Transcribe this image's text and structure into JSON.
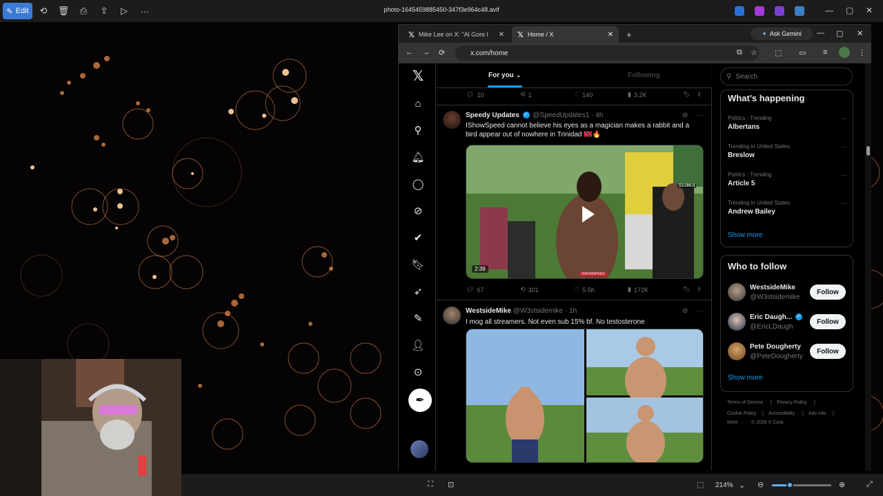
{
  "viewer": {
    "edit_label": "Edit",
    "file_name": "photo-1645459885450-347f3e964c48.avif",
    "zoom": "214%",
    "zoom_level_fraction": 0.3
  },
  "browser": {
    "tabs": [
      {
        "label": "Mike Lee on X: \"Al Gore has ca",
        "active": false
      },
      {
        "label": "Home / X",
        "active": true
      }
    ],
    "ask_gemini": "Ask Gemini",
    "url": "x.com/home"
  },
  "feed": {
    "tabs": {
      "for_you": "For you",
      "following": "Following"
    },
    "top_actions": {
      "replies": "10",
      "reposts": "1",
      "likes": "140",
      "views": "3.2K"
    },
    "posts": [
      {
        "name": "Speedy Updates",
        "handle": "@SpeedUpdates1",
        "time": "· 4h",
        "text": "IShowSpeed cannot believe his eyes as a magician makes a rabbit and a bird appear out of nowhere in Trinidad 🇹🇹🔥",
        "video_duration": "2:39",
        "video_overlay_count": "53,086,9",
        "video_watermark": "ISHOWSPEED",
        "actions": {
          "replies": "67",
          "reposts": "301",
          "likes": "5.5K",
          "views": "172K"
        }
      },
      {
        "name": "WestsideMike",
        "handle": "@W3stsidemike",
        "time": "· 1h",
        "text": "I mog all streamers. Not even sub 15% bf. No testosterone"
      }
    ]
  },
  "sidebar": {
    "search_placeholder": "Search",
    "happening_title": "What’s happening",
    "trends": [
      {
        "meta": "Politics · Trending",
        "name": "Albertans"
      },
      {
        "meta": "Trending in United States",
        "name": "Breslow"
      },
      {
        "meta": "Politics · Trending",
        "name": "Article 5"
      },
      {
        "meta": "Trending in United States",
        "name": "Andrew Bailey"
      }
    ],
    "show_more": "Show more",
    "wtf_title": "Who to follow",
    "who_to_follow": [
      {
        "name": "WestsideMike",
        "handle": "@W3stsidemike",
        "button": "Follow"
      },
      {
        "name": "Eric Daugh...",
        "handle": "@EricLDaugh",
        "button": "Follow"
      },
      {
        "name": "Pete Dougherty",
        "handle": "@PeteDougherty",
        "button": "Follow"
      }
    ],
    "footer": {
      "terms": "Terms of Service",
      "privacy": "Privacy Policy",
      "cookie": "Cookie Policy",
      "accessibility": "Accessibility",
      "ads": "Ads info",
      "more": "More ···",
      "copyright": "© 2026 X Corp."
    }
  },
  "colors": {
    "accent": "#1d9bf0",
    "edit_button": "#3b7bd6",
    "background": "#050303"
  }
}
